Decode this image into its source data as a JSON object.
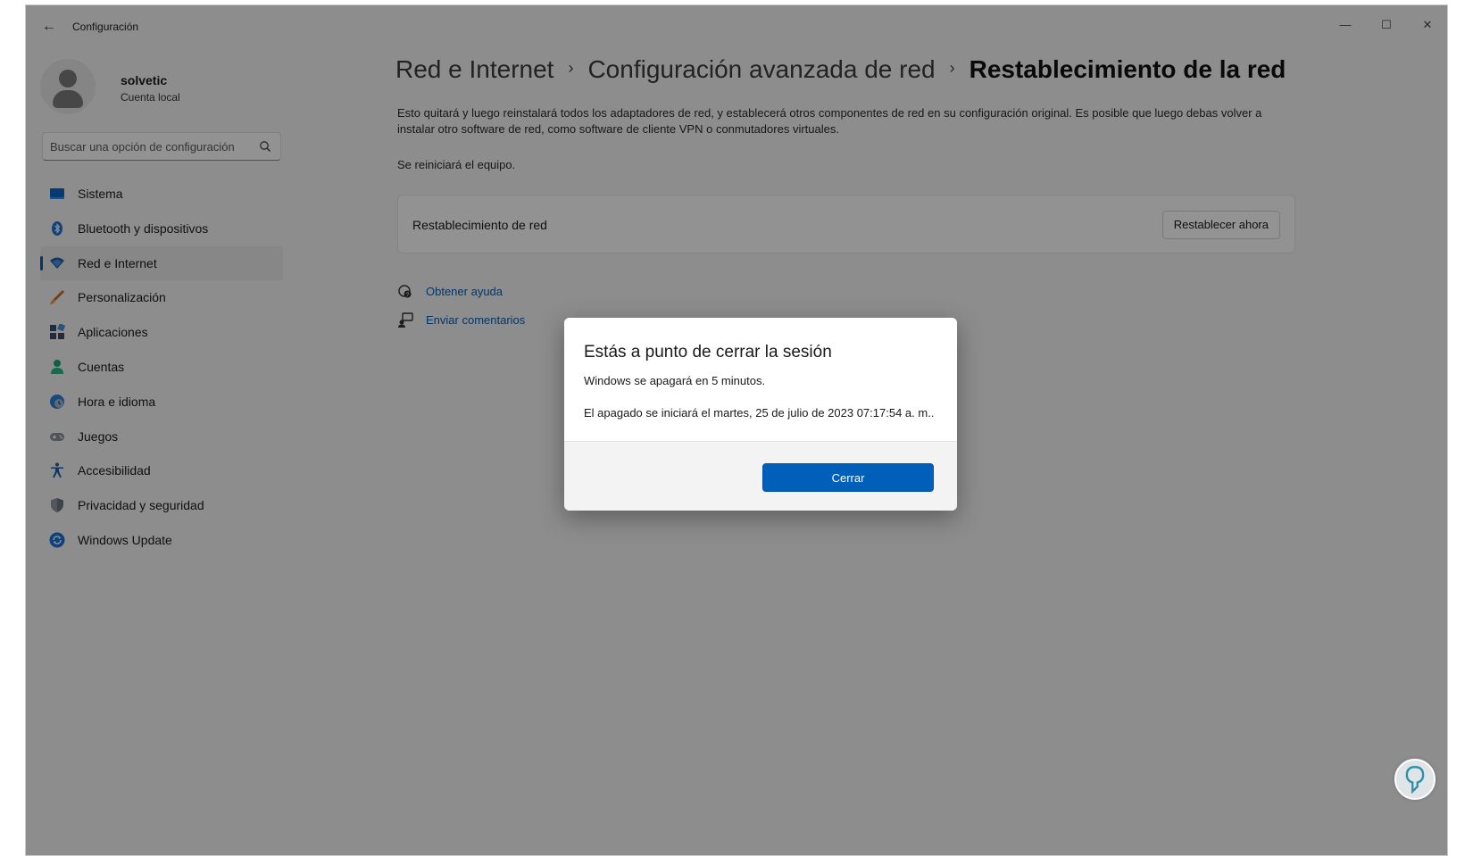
{
  "window": {
    "title": "Configuración",
    "controls": {
      "minimize": "—",
      "maximize": "☐",
      "close": "✕"
    }
  },
  "profile": {
    "name": "solvetic",
    "account_type": "Cuenta local"
  },
  "search": {
    "placeholder": "Buscar una opción de configuración"
  },
  "sidebar": {
    "items": [
      {
        "label": "Sistema",
        "icon": "system-icon",
        "active": false
      },
      {
        "label": "Bluetooth y dispositivos",
        "icon": "bluetooth-icon",
        "active": false
      },
      {
        "label": "Red e Internet",
        "icon": "wifi-icon",
        "active": true
      },
      {
        "label": "Personalización",
        "icon": "brush-icon",
        "active": false
      },
      {
        "label": "Aplicaciones",
        "icon": "apps-icon",
        "active": false
      },
      {
        "label": "Cuentas",
        "icon": "accounts-icon",
        "active": false
      },
      {
        "label": "Hora e idioma",
        "icon": "clock-globe-icon",
        "active": false
      },
      {
        "label": "Juegos",
        "icon": "gamepad-icon",
        "active": false
      },
      {
        "label": "Accesibilidad",
        "icon": "accessibility-icon",
        "active": false
      },
      {
        "label": "Privacidad y seguridad",
        "icon": "shield-icon",
        "active": false
      },
      {
        "label": "Windows Update",
        "icon": "update-icon",
        "active": false
      }
    ]
  },
  "breadcrumb": {
    "items": [
      "Red e Internet",
      "Configuración avanzada de red",
      "Restablecimiento de la red"
    ],
    "separator": "›"
  },
  "main": {
    "description": "Esto quitará y luego reinstalará todos los adaptadores de red, y establecerá otros componentes de red en su configuración original. Es posible que luego debas volver a instalar otro software de red, como software de cliente VPN o conmutadores virtuales.",
    "restart_note": "Se reiniciará el equipo.",
    "card_label": "Restablecimiento de red",
    "reset_button": "Restablecer ahora",
    "help_link": "Obtener ayuda",
    "feedback_link": "Enviar comentarios"
  },
  "dialog": {
    "title": "Estás a punto de cerrar la sesión",
    "message1": "Windows se apagará en 5 minutos.",
    "message2": "El apagado se iniciará el martes, 25 de julio de 2023 07:17:54 a. m..",
    "close_button": "Cerrar"
  },
  "colors": {
    "accent": "#005fb8",
    "link": "#0b5cad",
    "overlay": "rgba(0,0,0,0.42)"
  }
}
